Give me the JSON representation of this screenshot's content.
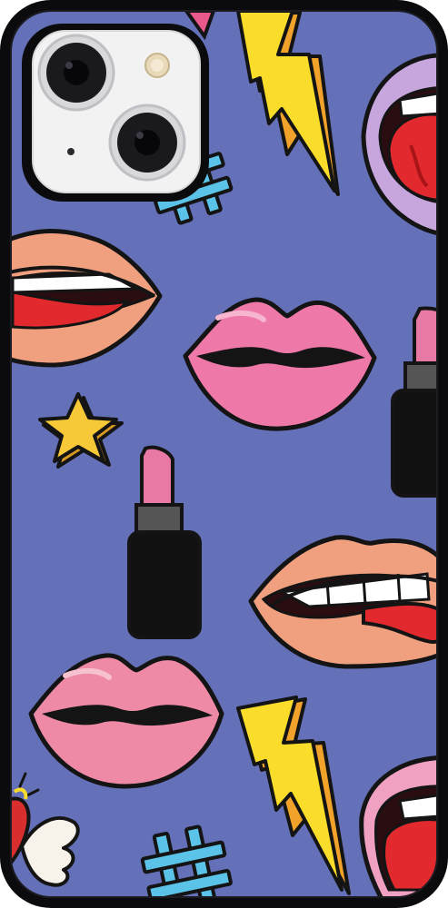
{
  "product": {
    "type": "phone-case",
    "colors": {
      "case_frame": "#0b0b0d",
      "background": "#6470b8",
      "camera_plate": "#f2f2f2",
      "lip_outline": "#141414",
      "pink_lips": "#ee78a8",
      "peach_lips": "#f0a07e",
      "red_tongue": "#e22a2e",
      "lilac_lips": "#c7a6de",
      "lightning_yellow": "#f9dd2a",
      "lightning_orange": "#f0a22a",
      "hashtag_blue": "#5cc3e8",
      "star_yellow": "#f7c938",
      "lipstick_body": "#111111",
      "lipstick_tip": "#e878a4",
      "wing_white": "#f7f2ea",
      "heart_red": "#d82e2e"
    }
  },
  "pattern": {
    "stickers": [
      "kissing-pink-lips-icon",
      "kissing-pink-lips-icon",
      "biting-lips-icon",
      "tongue-out-lips-icon",
      "open-mouth-lilac-lips-icon",
      "open-mouth-pink-lips-icon",
      "lipstick-icon",
      "lipstick-icon",
      "lightning-bolt-icon",
      "lightning-bolt-icon",
      "hashtag-icon",
      "hashtag-icon",
      "star-icon",
      "winged-heart-icon"
    ]
  }
}
